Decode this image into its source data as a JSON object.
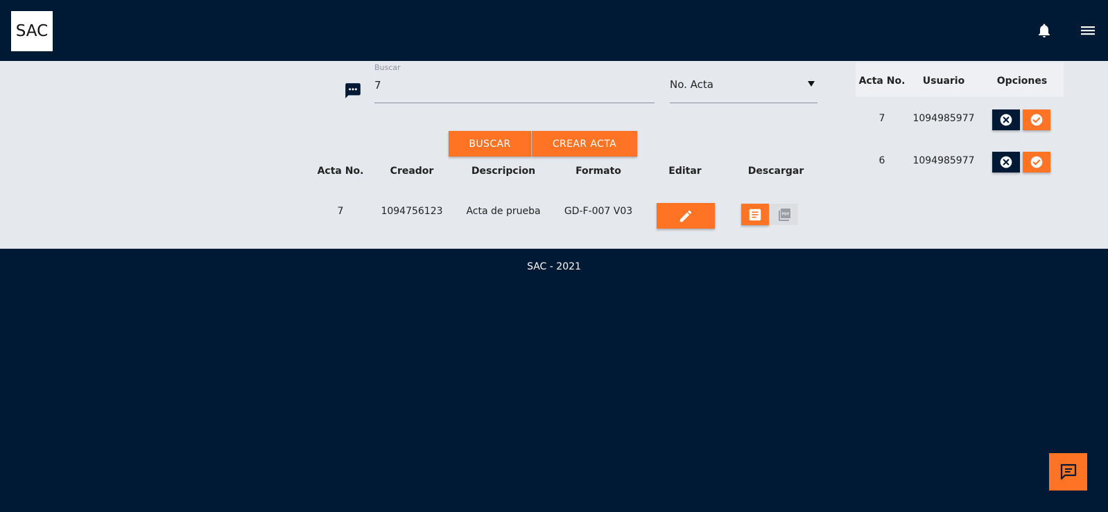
{
  "header": {
    "logo_text": "SAC",
    "bell_icon": "bell-icon",
    "menu_icon": "menu-icon"
  },
  "search": {
    "label": "Buscar",
    "value": "7",
    "icon": "chat-dots-icon"
  },
  "filter": {
    "selected": "No. Acta"
  },
  "buttons": {
    "buscar": "BUSCAR",
    "crear_acta": "CREAR ACTA"
  },
  "actas_table": {
    "headers": [
      "Acta No.",
      "Creador",
      "Descripcion",
      "Formato",
      "Editar",
      "Descargar"
    ],
    "rows": [
      {
        "acta_no": "7",
        "creador": "1094756123",
        "descripcion": "Acta de prueba",
        "formato": "GD-F-007 V03"
      }
    ]
  },
  "approvals_table": {
    "headers": [
      "Acta No.",
      "Usuario",
      "Opciones"
    ],
    "rows": [
      {
        "acta_no": "7",
        "usuario": "1094985977"
      },
      {
        "acta_no": "6",
        "usuario": "1094985977"
      }
    ]
  },
  "footer": {
    "text": "SAC - 2021"
  },
  "colors": {
    "navy": "#001a35",
    "orange": "#ff7324",
    "content_bg": "#e5e8ed"
  }
}
